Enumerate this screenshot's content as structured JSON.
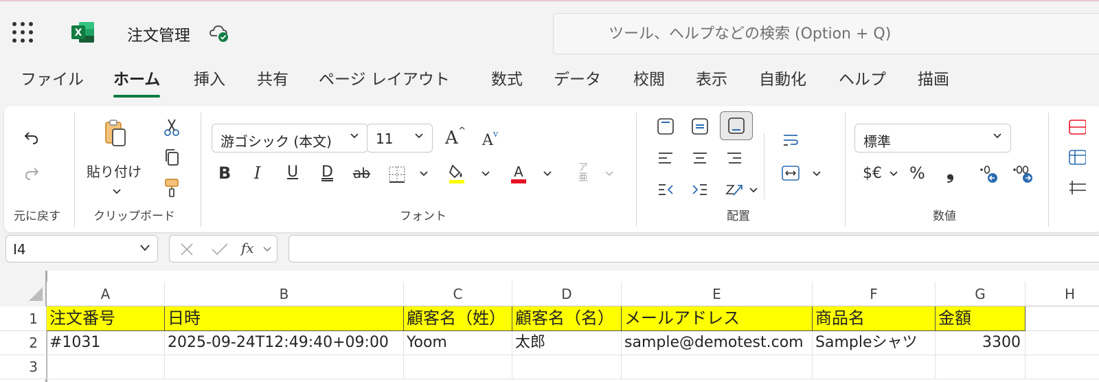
{
  "titlebar": {
    "doc_title": "注文管理",
    "search_placeholder": "ツール、ヘルプなどの検索 (Option + Q)",
    "excel_letter": "X"
  },
  "tabs": [
    {
      "label": "ファイル",
      "active": false
    },
    {
      "label": "ホーム",
      "active": true
    },
    {
      "label": "挿入",
      "active": false
    },
    {
      "label": "共有",
      "active": false
    },
    {
      "label": "ページ レイアウト",
      "active": false
    },
    {
      "label": "数式",
      "active": false
    },
    {
      "label": "データ",
      "active": false
    },
    {
      "label": "校閲",
      "active": false
    },
    {
      "label": "表示",
      "active": false
    },
    {
      "label": "自動化",
      "active": false
    },
    {
      "label": "ヘルプ",
      "active": false
    },
    {
      "label": "描画",
      "active": false
    }
  ],
  "ribbon": {
    "undo_group": "元に戻す",
    "clipboard_group": "クリップボード",
    "paste_label": "貼り付け",
    "font_group": "フォント",
    "font_name": "游ゴシック (本文)",
    "font_size": "11",
    "align_group": "配置",
    "number_group": "数値",
    "number_format": "標準",
    "currency_label": "$€",
    "percent_label": "%",
    "comma_label": "❟",
    "bold": "B",
    "italic": "I",
    "underline": "U",
    "double_underline": "D",
    "strike": "ab",
    "grow_font": "A",
    "shrink_font": "A",
    "font_color_letter": "A",
    "phonetic_top": "ア",
    "phonetic_bottom": "亜"
  },
  "formula_bar": {
    "name_box": "I4",
    "fx_label": "fx",
    "formula": ""
  },
  "sheet": {
    "columns": [
      "A",
      "B",
      "C",
      "D",
      "E",
      "F",
      "G",
      "H"
    ],
    "rows": [
      "1",
      "2",
      "3"
    ],
    "header_row": [
      "注文番号",
      "日時",
      "顧客名（姓）",
      "顧客名（名）",
      "メールアドレス",
      "商品名",
      "金額"
    ],
    "data_row": [
      "#1031",
      "2025-09-24T12:49:40+09:00",
      "Yoom",
      "太郎",
      "sample@demotest.com",
      "Sampleシャツ",
      "3300"
    ]
  },
  "colors": {
    "accent": "#107c41",
    "header_fill": "#ffff00",
    "font_color": "#e81123",
    "highlight": "#ffff00"
  }
}
